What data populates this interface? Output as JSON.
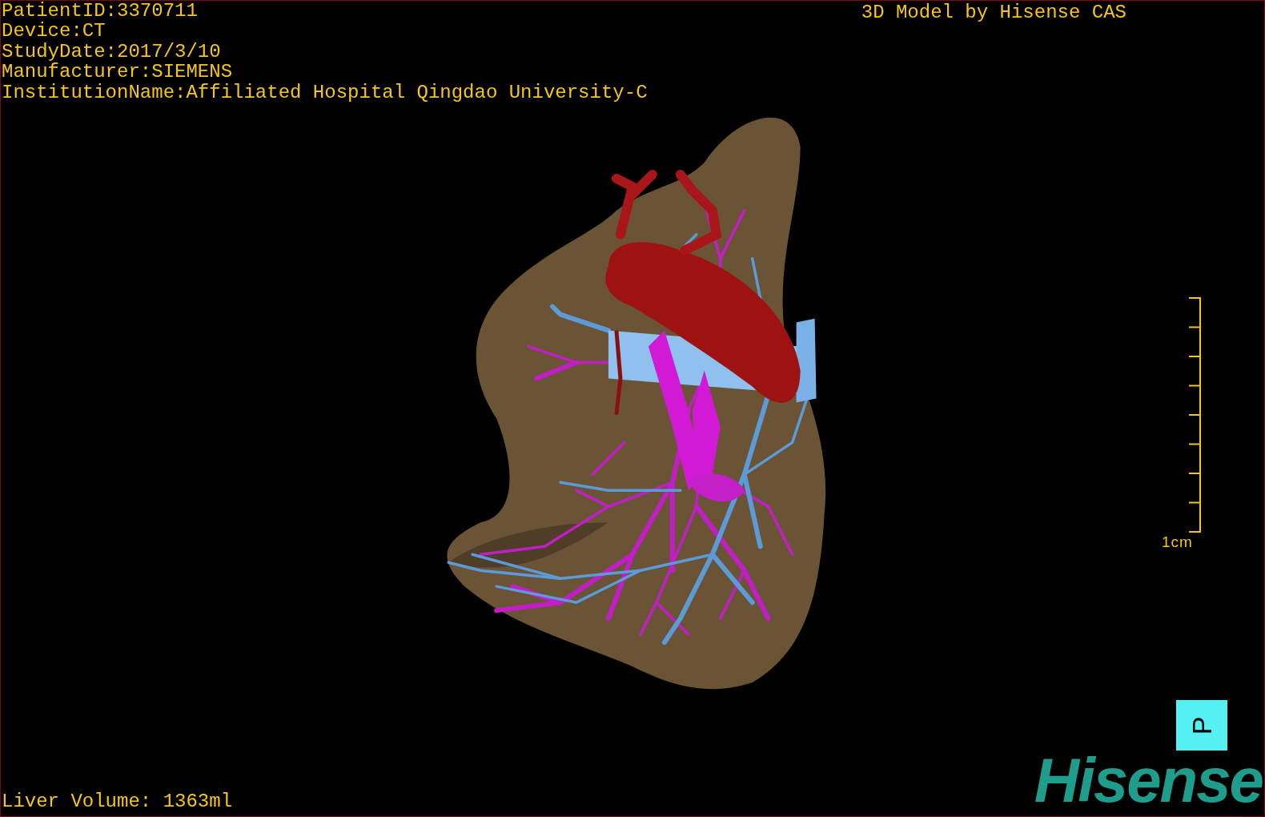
{
  "patient_info": [
    "PatientID:3370711",
    "Device:CT",
    "StudyDate:2017/3/10",
    "Manufacturer:SIEMENS",
    "InstitutionName:Affiliated Hospital Qingdao University-C"
  ],
  "model_title": "3D Model by Hisense CAS",
  "scale_bar": {
    "label": "1cm"
  },
  "orientation_marker": "P",
  "liver_volume": "Liver Volume: 1363ml",
  "logo": "Hisense"
}
